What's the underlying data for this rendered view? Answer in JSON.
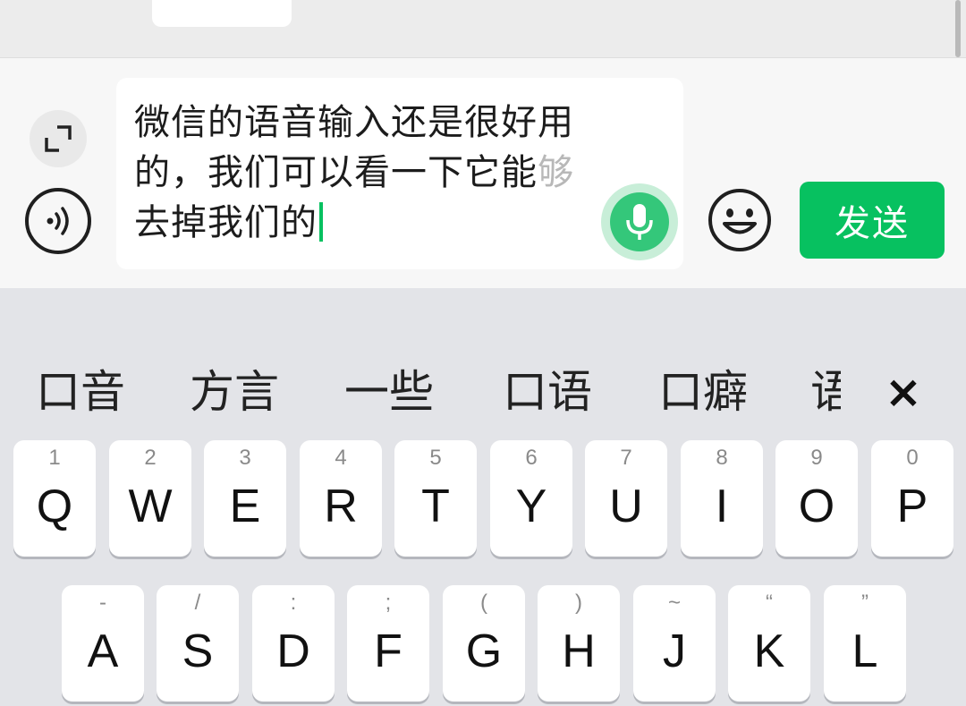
{
  "input": {
    "text": "微信的语音输入还是很好用的，我们可以看一下它能",
    "text_faded": "够",
    "text_line3": "去掉我们的"
  },
  "send_label": "发送",
  "candidates": [
    "口音",
    "方言",
    "一些",
    "口语",
    "口癖",
    "语"
  ],
  "close_symbol": "×",
  "keys_row1": [
    {
      "sub": "1",
      "main": "Q"
    },
    {
      "sub": "2",
      "main": "W"
    },
    {
      "sub": "3",
      "main": "E"
    },
    {
      "sub": "4",
      "main": "R"
    },
    {
      "sub": "5",
      "main": "T"
    },
    {
      "sub": "6",
      "main": "Y"
    },
    {
      "sub": "7",
      "main": "U"
    },
    {
      "sub": "8",
      "main": "I"
    },
    {
      "sub": "9",
      "main": "O"
    },
    {
      "sub": "0",
      "main": "P"
    }
  ],
  "keys_row2": [
    {
      "sub": "-",
      "main": "A"
    },
    {
      "sub": "/",
      "main": "S"
    },
    {
      "sub": ":",
      "main": "D"
    },
    {
      "sub": ";",
      "main": "F"
    },
    {
      "sub": "(",
      "main": "G"
    },
    {
      "sub": ")",
      "main": "H"
    },
    {
      "sub": "~",
      "main": "J"
    },
    {
      "sub": "“",
      "main": "K"
    },
    {
      "sub": "”",
      "main": "L"
    }
  ],
  "colors": {
    "accent": "#07c160",
    "keyboard_bg": "#e3e4e8",
    "key_bg": "#ffffff"
  },
  "icons": {
    "expand": "expand-icon",
    "voice": "voice-mode-icon",
    "mic": "microphone-icon",
    "emoji": "emoji-icon"
  }
}
